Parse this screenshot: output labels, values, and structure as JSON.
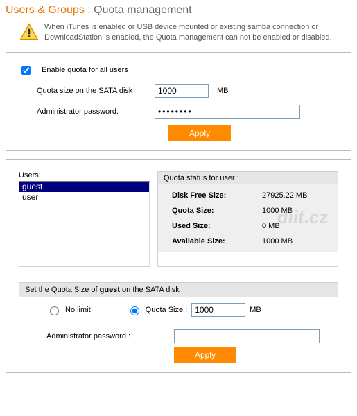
{
  "header": {
    "section": "Users & Groups :",
    "page": "Quota management"
  },
  "notice": "When iTunes is enabled or USB device mounted or existing samba connection or DownloadStation is enabled, the Quota management can not be enabled or disabled.",
  "top": {
    "enable_label": "Enable quota for all users",
    "quota_label": "Quota size on the SATA disk",
    "quota_value": "1000",
    "unit": "MB",
    "admin_label": "Administrator password:",
    "admin_value": "••••••••",
    "apply": "Apply"
  },
  "bottom": {
    "users_label": "Users:",
    "users": [
      {
        "name": "guest",
        "selected": true
      },
      {
        "name": "user",
        "selected": false
      }
    ],
    "status_head": "Quota status for user :",
    "status": {
      "free_k": "Disk Free Size:",
      "free_v": "27925.22 MB",
      "quota_k": "Quota Size:",
      "quota_v": "1000 MB",
      "used_k": "Used Size:",
      "used_v": "0 MB",
      "avail_k": "Available Size:",
      "avail_v": "1000 MB"
    },
    "set_head_pre": "Set the Quota Size of ",
    "set_head_user": "guest",
    "set_head_post": " on the SATA disk",
    "no_limit": "No limit",
    "quota_size_label": "Quota Size :",
    "quota_size_value": "1000",
    "unit": "MB",
    "admin_label": "Administrator password :",
    "admin_value": "",
    "apply": "Apply"
  },
  "watermark": "diit.cz"
}
